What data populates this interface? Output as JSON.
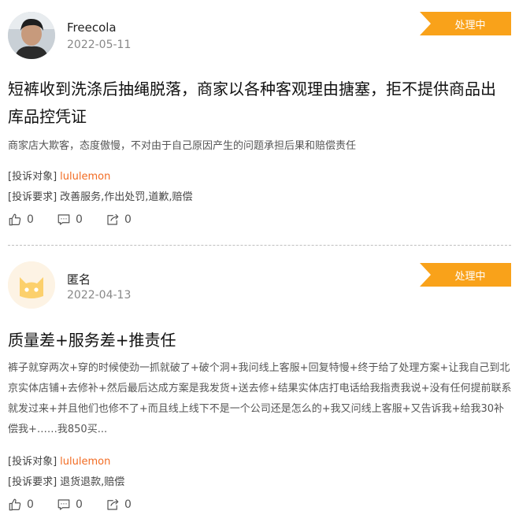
{
  "posts": [
    {
      "username": "Freecola",
      "date": "2022-05-11",
      "status": "处理中",
      "title": "短裤收到洗涤后抽绳脱落，商家以各种客观理由搪塞，拒不提供商品出库品控凭证",
      "description": "商家店大欺客，态度傲慢，不对由于自己原因产生的问题承担后果和赔偿责任",
      "target_label": "[投诉对象]",
      "target_value": "lululemon",
      "demand_label": "[投诉要求]",
      "demand_value": "改善服务,作出处罚,道歉,赔偿",
      "likes": "0",
      "comments": "0",
      "shares": "0"
    },
    {
      "username": "匿名",
      "date": "2022-04-13",
      "status": "处理中",
      "title": "质量差+服务差+推责任",
      "description": "裤子就穿两次+穿的时候使劲一抓就破了+破个洞+我问线上客服+回复特慢+终于给了处理方案+让我自己到北京实体店铺+去修补+然后最后达成方案是我发货+送去修+结果实体店打电话给我指责我说+没有任何提前联系就发过来+并且他们也修不了+而且线上线下不是一个公司还是怎么的+我又问线上客服+又告诉我+给我30补偿我+……我850买...",
      "target_label": "[投诉对象]",
      "target_value": "lululemon",
      "demand_label": "[投诉要求]",
      "demand_value": "退货退款,赔偿",
      "likes": "0",
      "comments": "0",
      "shares": "0"
    }
  ],
  "colors": {
    "badge": "#f9a21a",
    "brand_link": "#f26b22"
  },
  "icons": {
    "like": "thumbs-up-icon",
    "comment": "comment-icon",
    "share": "share-icon"
  }
}
